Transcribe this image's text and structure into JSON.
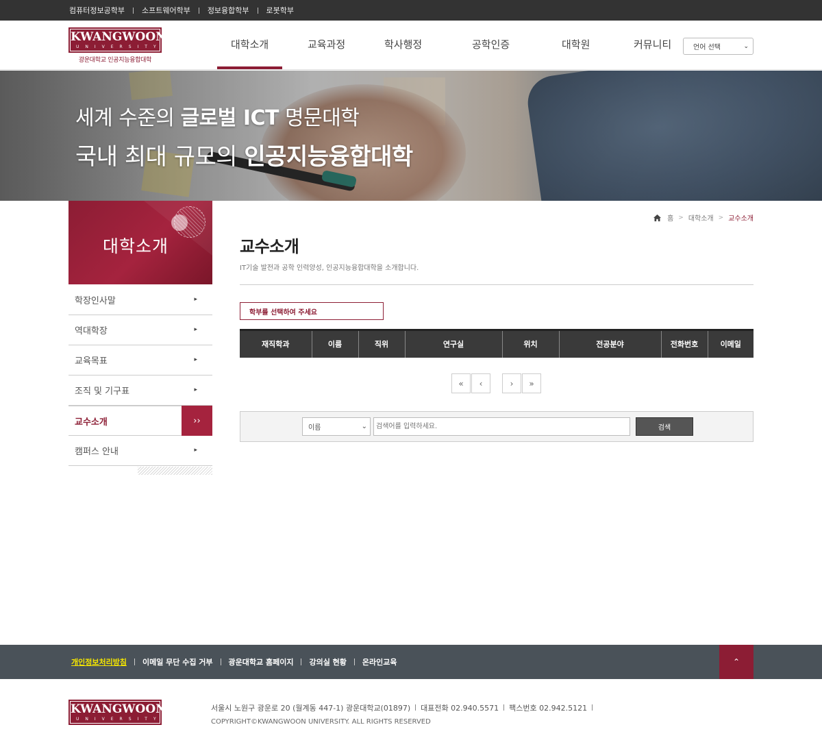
{
  "topbar": {
    "links": [
      "컴퓨터정보공학부",
      "소프트웨어학부",
      "정보융합학부",
      "로봇학부"
    ]
  },
  "logo": {
    "word": "KWANGWOON",
    "sub": "UNIVERSITY",
    "caption": "광운대학교 인공지능융합대학"
  },
  "gnb": {
    "items": [
      "대학소개",
      "교육과정",
      "학사행정",
      "공학인증",
      "대학원",
      "커뮤니티"
    ],
    "active": "대학소개"
  },
  "language": {
    "label": "언어 선택"
  },
  "banner": {
    "line1_pre": "세계 수준의 ",
    "line1_bold": "글로벌 ICT",
    "line1_post": " 명문대학",
    "line2_pre": "국내 최대 규모의 ",
    "line2_bold": "인공지능융합대학"
  },
  "sidebar": {
    "title": "대학소개",
    "items": [
      "학장인사말",
      "역대학장",
      "교육목표",
      "조직 및 기구표",
      "교수소개",
      "캠퍼스 안내"
    ],
    "active": "교수소개"
  },
  "breadcrumb": {
    "home": "홈",
    "level1": "대학소개",
    "current": "교수소개"
  },
  "content": {
    "title": "교수소개",
    "description": "IT기술 발전과 공학 인력양성, 인공지능융합대학을 소개합니다.",
    "dept_select": "학부를 선택하여 주세요",
    "table_headers": [
      "재직학과",
      "이름",
      "직위",
      "연구실",
      "위치",
      "전공분야",
      "전화번호",
      "이메일"
    ]
  },
  "pager": {
    "first": "«",
    "prev": "‹",
    "next": "›",
    "last": "»"
  },
  "search": {
    "field_selected": "이름",
    "placeholder": "검색어를 입력하세요.",
    "button": "검색"
  },
  "footer": {
    "links": [
      "개인정보처리방침",
      "이메일 무단 수집 거부",
      "광운대학교 홈페이지",
      "강의실 현황",
      "온라인교육"
    ],
    "address": "서울시 노원구 광운로 20 (월계동 447-1) 광운대학교(01897)",
    "phone": "대표전화 02.940.5571",
    "fax": "팩스번호 02.942.5121",
    "copyright": "COPYRIGHT©KWANGWOON UNIVERSITY. ALL RIGHTS RESERVED"
  },
  "colors": {
    "brand": "#8c1d34",
    "accent": "#a5233e",
    "footer_bar": "#4a5259",
    "highlight": "#f5e600"
  }
}
